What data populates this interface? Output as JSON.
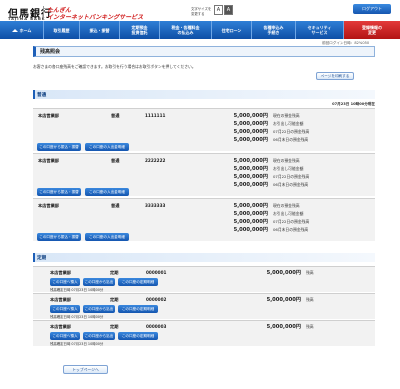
{
  "header": {
    "logo_kanji": "但馬銀行",
    "logo_roman": "TAJIMA BANK",
    "tagline_line1": "たんぎん",
    "tagline_line2": "インターネットバンキングサービス",
    "font_size_label_line1": "文字サイズを",
    "font_size_label_line2": "変更する",
    "font_small": "A",
    "font_large": "A",
    "logout_label": "ログアウト"
  },
  "nav": {
    "items": [
      {
        "label": "ホーム",
        "icon": "home-icon"
      },
      {
        "label": "取引履歴"
      },
      {
        "label": "振込・振替"
      },
      {
        "label": "定期預金\n投資信託"
      },
      {
        "label": "税金・各種料金\nの払込み"
      },
      {
        "label": "住宅ローン"
      },
      {
        "label": "各種申込み\n手続き"
      },
      {
        "label": "セキュリティ\nサービス"
      },
      {
        "label": "登録情報の\n変更"
      }
    ]
  },
  "last_login": "前回ログイン日時：82%050",
  "page": {
    "title": "残高照会",
    "instruction": "お客さまの各口座残高をご確認できます。お取引を行う場合はお取引ボタンを押してください。",
    "print_button": "ページを印刷する",
    "top_button": "トップページへ"
  },
  "ordinary": {
    "section_title": "普通",
    "timestamp": "07月23日 10時00分現在",
    "accounts": [
      {
        "branch": "本店営業部",
        "type": "普通",
        "number": "1111111",
        "balances": [
          {
            "amount": "5,000,000円",
            "label": "現在の預金残高"
          },
          {
            "amount": "5,000,000円",
            "label": "お引出し可能金額"
          },
          {
            "amount": "5,000,000円",
            "label": "07月22日の預金残高"
          },
          {
            "amount": "5,000,000円",
            "label": "06月末日の預金残高"
          }
        ],
        "buttons": [
          "この口座から振込・振替",
          "この口座の入出金明細"
        ]
      },
      {
        "branch": "本店営業部",
        "type": "普通",
        "number": "2222222",
        "balances": [
          {
            "amount": "5,000,000円",
            "label": "現在の預金残高"
          },
          {
            "amount": "5,000,000円",
            "label": "お引出し可能金額"
          },
          {
            "amount": "5,000,000円",
            "label": "07月22日の預金残高"
          },
          {
            "amount": "5,000,000円",
            "label": "06月末日の預金残高"
          }
        ],
        "buttons": [
          "この口座から振込・振替",
          "この口座の入出金明細"
        ]
      },
      {
        "branch": "本店営業部",
        "type": "普通",
        "number": "3333333",
        "balances": [
          {
            "amount": "5,000,000円",
            "label": "現在の預金残高"
          },
          {
            "amount": "5,000,000円",
            "label": "お引出し可能金額"
          },
          {
            "amount": "5,000,000円",
            "label": "07月22日の預金残高"
          },
          {
            "amount": "5,000,000円",
            "label": "06月末日の預金残高"
          }
        ],
        "buttons": [
          "この口座から振込・振替",
          "この口座の入出金明細"
        ]
      }
    ]
  },
  "time_deposit": {
    "section_title": "定期",
    "accounts": [
      {
        "branch": "本店営業部",
        "type": "定期",
        "number": "0000001",
        "amount": "5,000,000円",
        "label": "残高",
        "date": "残高確定日時 07月23日 10時00分",
        "buttons": [
          "この口座へ預入",
          "この口座から払出",
          "この口座の定期明細"
        ]
      },
      {
        "branch": "本店営業部",
        "type": "定期",
        "number": "0000002",
        "amount": "5,000,000円",
        "label": "残高",
        "date": "残高確定日時 07月23日 10時00分",
        "buttons": [
          "この口座へ預入",
          "この口座から払出",
          "この口座の定期明細"
        ]
      },
      {
        "branch": "本店営業部",
        "type": "定期",
        "number": "0000003",
        "amount": "5,000,000円",
        "label": "残高",
        "date": "残高確定日時 07月23日 10時00分",
        "buttons": [
          "この口座へ預入",
          "この口座から払出",
          "この口座の定期明細"
        ]
      }
    ]
  },
  "colors": {
    "nav_blue": "#0e4fa6",
    "nav_highlight_red": "#b31414",
    "brand_red": "#d01a1a",
    "button_blue": "#1556b0"
  }
}
